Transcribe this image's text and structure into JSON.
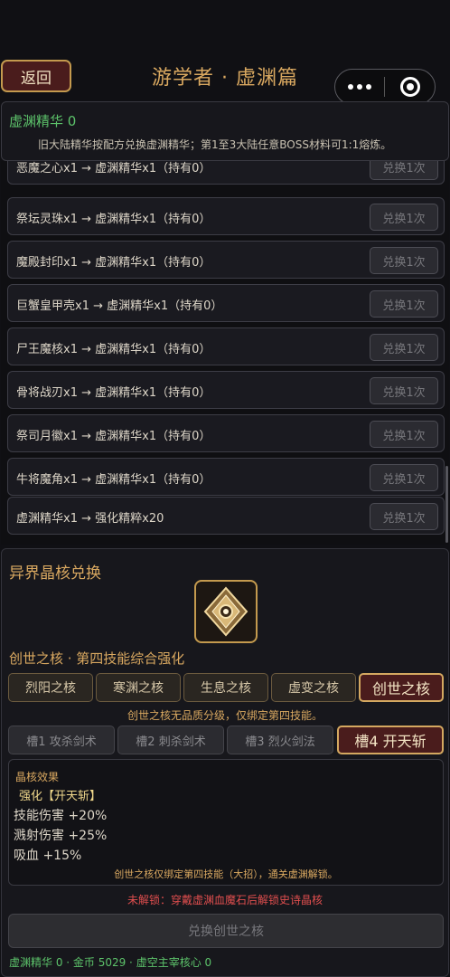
{
  "header": {
    "back_label": "返回",
    "title": "游学者 · 虚渊篇"
  },
  "essence": {
    "count_text": "虚渊精华 0",
    "note": "旧大陆精华按配方兑换虚渊精华；第1至3大陆任意BOSS材料可1:1熔炼。"
  },
  "recipes": [
    {
      "label": "恶魔之心x1 → 虚渊精华x1（持有0）",
      "button": "兑换1次"
    },
    {
      "label": "祭坛灵珠x1 → 虚渊精华x1（持有0）",
      "button": "兑换1次"
    },
    {
      "label": "魔殿封印x1 → 虚渊精华x1（持有0）",
      "button": "兑换1次"
    },
    {
      "label": "巨蟹皇甲壳x1 → 虚渊精华x1（持有0）",
      "button": "兑换1次"
    },
    {
      "label": "尸王魔核x1 → 虚渊精华x1（持有0）",
      "button": "兑换1次"
    },
    {
      "label": "骨将战刃x1 → 虚渊精华x1（持有0）",
      "button": "兑换1次"
    },
    {
      "label": "祭司月徽x1 → 虚渊精华x1（持有0）",
      "button": "兑换1次"
    },
    {
      "label": "牛将魔角x1 → 虚渊精华x1（持有0）",
      "button": "兑换1次"
    },
    {
      "label": "虚渊精华x1 → 强化精粹x20",
      "button": "兑换1次"
    }
  ],
  "crystal": {
    "heading": "异界晶核兑换",
    "icon": "crystal-core-icon",
    "core_title": "创世之核 · 第四技能综合强化",
    "core_tabs": [
      "烈阳之核",
      "寒渊之核",
      "生息之核",
      "虚变之核",
      "创世之核"
    ],
    "active_core": 4,
    "core_desc": "创世之核无品质分级，仅绑定第四技能。",
    "slot_tabs": [
      "槽1 攻杀剑术",
      "槽2 刺杀剑术",
      "槽3 烈火剑法",
      "槽4 开天斩"
    ],
    "active_slot": 3,
    "effects": {
      "heading": "晶核效果",
      "skill": "强化【开天斩】",
      "lines": [
        "技能伤害 +20%",
        "溅射伤害 +25%",
        "吸血 +15%"
      ],
      "note": "创世之核仅绑定第四技能（大招），通关虚渊解锁。"
    },
    "locked_text": "未解锁：穿戴虚渊血魔石后解锁史诗晶核",
    "exchange_label": "兑换创世之核"
  },
  "footer": {
    "text": "虚渊精华 0 · 金币 5029 · 虚空主宰核心 0"
  },
  "colors": {
    "accent_gold": "#d9a860",
    "essence_green": "#5cc26a",
    "locked_red": "#e04e4e",
    "active_tab_bg": "#4a1c1c"
  }
}
